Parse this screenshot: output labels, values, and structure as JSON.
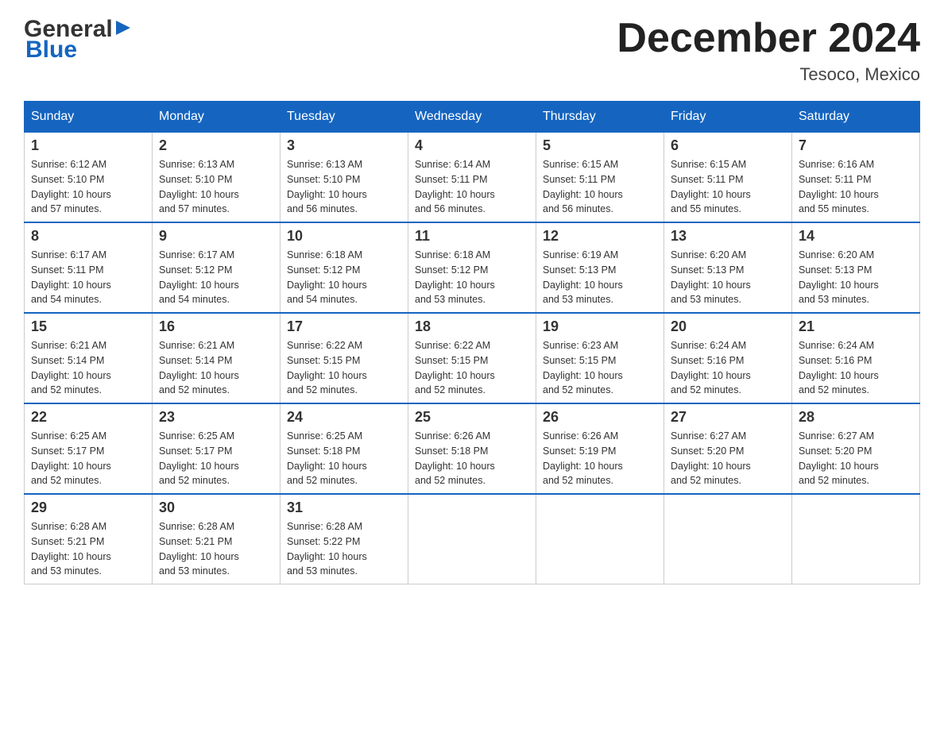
{
  "header": {
    "logo": {
      "general": "General",
      "blue": "Blue"
    },
    "title": "December 2024",
    "location": "Tesoco, Mexico"
  },
  "days_of_week": [
    "Sunday",
    "Monday",
    "Tuesday",
    "Wednesday",
    "Thursday",
    "Friday",
    "Saturday"
  ],
  "weeks": [
    [
      {
        "day": "1",
        "sunrise": "6:12 AM",
        "sunset": "5:10 PM",
        "daylight": "10 hours and 57 minutes."
      },
      {
        "day": "2",
        "sunrise": "6:13 AM",
        "sunset": "5:10 PM",
        "daylight": "10 hours and 57 minutes."
      },
      {
        "day": "3",
        "sunrise": "6:13 AM",
        "sunset": "5:10 PM",
        "daylight": "10 hours and 56 minutes."
      },
      {
        "day": "4",
        "sunrise": "6:14 AM",
        "sunset": "5:11 PM",
        "daylight": "10 hours and 56 minutes."
      },
      {
        "day": "5",
        "sunrise": "6:15 AM",
        "sunset": "5:11 PM",
        "daylight": "10 hours and 56 minutes."
      },
      {
        "day": "6",
        "sunrise": "6:15 AM",
        "sunset": "5:11 PM",
        "daylight": "10 hours and 55 minutes."
      },
      {
        "day": "7",
        "sunrise": "6:16 AM",
        "sunset": "5:11 PM",
        "daylight": "10 hours and 55 minutes."
      }
    ],
    [
      {
        "day": "8",
        "sunrise": "6:17 AM",
        "sunset": "5:11 PM",
        "daylight": "10 hours and 54 minutes."
      },
      {
        "day": "9",
        "sunrise": "6:17 AM",
        "sunset": "5:12 PM",
        "daylight": "10 hours and 54 minutes."
      },
      {
        "day": "10",
        "sunrise": "6:18 AM",
        "sunset": "5:12 PM",
        "daylight": "10 hours and 54 minutes."
      },
      {
        "day": "11",
        "sunrise": "6:18 AM",
        "sunset": "5:12 PM",
        "daylight": "10 hours and 53 minutes."
      },
      {
        "day": "12",
        "sunrise": "6:19 AM",
        "sunset": "5:13 PM",
        "daylight": "10 hours and 53 minutes."
      },
      {
        "day": "13",
        "sunrise": "6:20 AM",
        "sunset": "5:13 PM",
        "daylight": "10 hours and 53 minutes."
      },
      {
        "day": "14",
        "sunrise": "6:20 AM",
        "sunset": "5:13 PM",
        "daylight": "10 hours and 53 minutes."
      }
    ],
    [
      {
        "day": "15",
        "sunrise": "6:21 AM",
        "sunset": "5:14 PM",
        "daylight": "10 hours and 52 minutes."
      },
      {
        "day": "16",
        "sunrise": "6:21 AM",
        "sunset": "5:14 PM",
        "daylight": "10 hours and 52 minutes."
      },
      {
        "day": "17",
        "sunrise": "6:22 AM",
        "sunset": "5:15 PM",
        "daylight": "10 hours and 52 minutes."
      },
      {
        "day": "18",
        "sunrise": "6:22 AM",
        "sunset": "5:15 PM",
        "daylight": "10 hours and 52 minutes."
      },
      {
        "day": "19",
        "sunrise": "6:23 AM",
        "sunset": "5:15 PM",
        "daylight": "10 hours and 52 minutes."
      },
      {
        "day": "20",
        "sunrise": "6:24 AM",
        "sunset": "5:16 PM",
        "daylight": "10 hours and 52 minutes."
      },
      {
        "day": "21",
        "sunrise": "6:24 AM",
        "sunset": "5:16 PM",
        "daylight": "10 hours and 52 minutes."
      }
    ],
    [
      {
        "day": "22",
        "sunrise": "6:25 AM",
        "sunset": "5:17 PM",
        "daylight": "10 hours and 52 minutes."
      },
      {
        "day": "23",
        "sunrise": "6:25 AM",
        "sunset": "5:17 PM",
        "daylight": "10 hours and 52 minutes."
      },
      {
        "day": "24",
        "sunrise": "6:25 AM",
        "sunset": "5:18 PM",
        "daylight": "10 hours and 52 minutes."
      },
      {
        "day": "25",
        "sunrise": "6:26 AM",
        "sunset": "5:18 PM",
        "daylight": "10 hours and 52 minutes."
      },
      {
        "day": "26",
        "sunrise": "6:26 AM",
        "sunset": "5:19 PM",
        "daylight": "10 hours and 52 minutes."
      },
      {
        "day": "27",
        "sunrise": "6:27 AM",
        "sunset": "5:20 PM",
        "daylight": "10 hours and 52 minutes."
      },
      {
        "day": "28",
        "sunrise": "6:27 AM",
        "sunset": "5:20 PM",
        "daylight": "10 hours and 52 minutes."
      }
    ],
    [
      {
        "day": "29",
        "sunrise": "6:28 AM",
        "sunset": "5:21 PM",
        "daylight": "10 hours and 53 minutes."
      },
      {
        "day": "30",
        "sunrise": "6:28 AM",
        "sunset": "5:21 PM",
        "daylight": "10 hours and 53 minutes."
      },
      {
        "day": "31",
        "sunrise": "6:28 AM",
        "sunset": "5:22 PM",
        "daylight": "10 hours and 53 minutes."
      },
      null,
      null,
      null,
      null
    ]
  ],
  "labels": {
    "sunrise": "Sunrise:",
    "sunset": "Sunset:",
    "daylight": "Daylight:"
  },
  "accent_color": "#1565C0"
}
